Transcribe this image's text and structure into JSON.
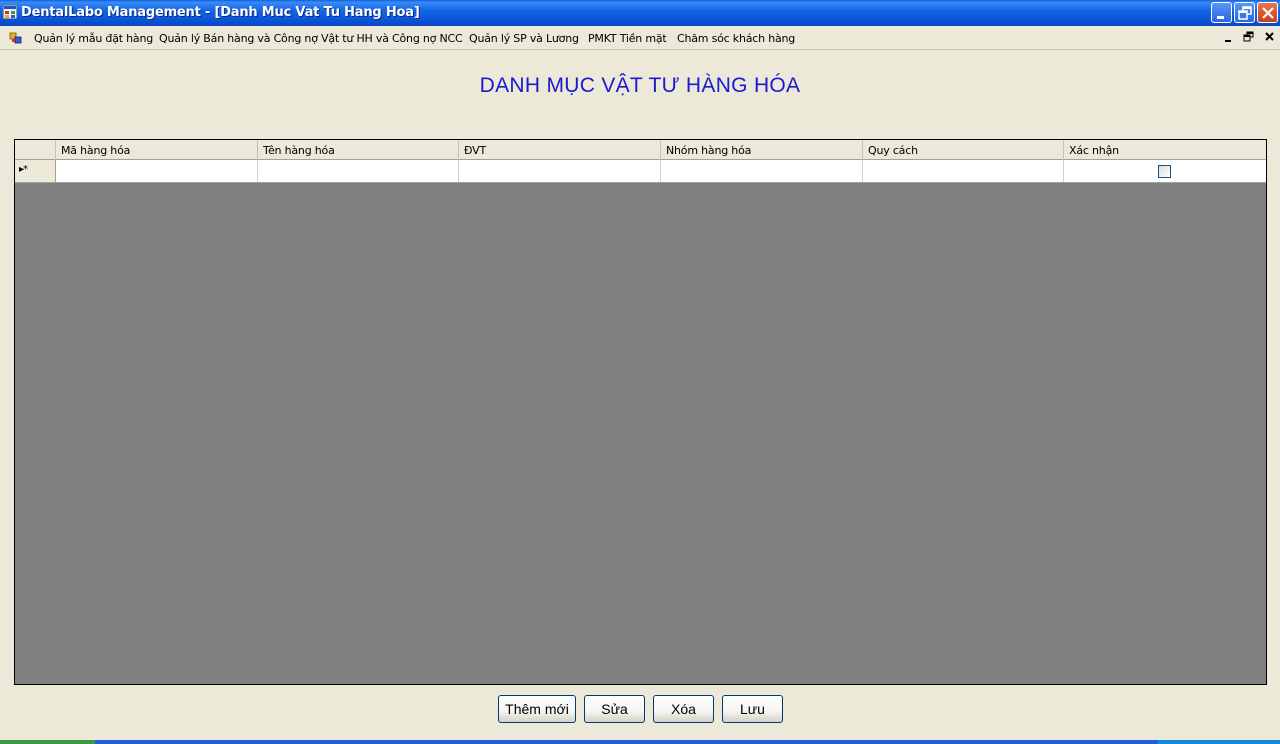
{
  "window": {
    "title": "DentalLabo Management - [Danh Muc Vat Tu Hang Hoa]"
  },
  "menu": {
    "items": [
      "Quản lý mẫu đặt hàng",
      "Quản lý Bán hàng và Công nợ",
      "Vật tư HH và Công nợ NCC",
      "Quản lý SP và Lương",
      "PMKT Tiền mặt",
      "Chăm sóc khách hàng"
    ]
  },
  "form": {
    "heading": "DANH MỤC VẬT TƯ HÀNG HÓA"
  },
  "grid": {
    "columns": [
      "Mã hàng hóa",
      "Tên hàng hóa",
      "ĐVT",
      "Nhóm hàng hóa",
      "Quy cách",
      "Xác nhận"
    ],
    "new_row_marker": "▸*",
    "new_row_checked": false
  },
  "buttons": {
    "add": "Thêm mới",
    "edit": "Sửa",
    "delete": "Xóa",
    "save": "Lưu"
  }
}
